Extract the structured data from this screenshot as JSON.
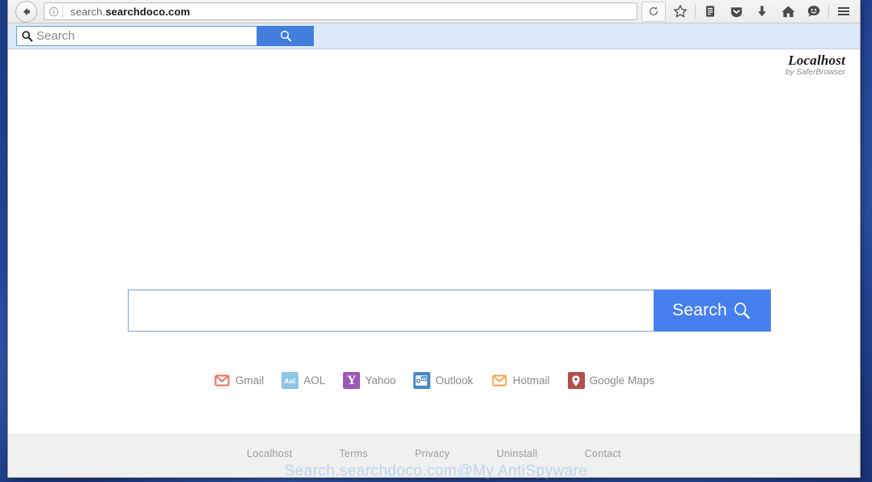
{
  "browser": {
    "back_icon": "back-arrow-icon",
    "identity_icon": "info-circle-icon",
    "url_prefix": "search.",
    "url_domain": "searchdoco.com",
    "url_full": "search.searchdoco.com",
    "reload_icon": "reload-icon",
    "toolbar_icons": [
      {
        "name": "bookmark-star-icon",
        "title": "Bookmark this page"
      },
      {
        "name": "reader-list-icon",
        "title": "Show your library"
      },
      {
        "name": "pocket-shield-icon",
        "title": "Save to Pocket"
      },
      {
        "name": "download-arrow-icon",
        "title": "Downloads"
      },
      {
        "name": "home-icon",
        "title": "Home"
      },
      {
        "name": "feedback-smiley-icon",
        "title": "Feedback"
      },
      {
        "name": "hamburger-menu-icon",
        "title": "Open menu"
      }
    ],
    "search_toolbar": {
      "placeholder": "Search",
      "magnifier_icon": "search-icon",
      "go_icon": "search-icon",
      "accent_color": "#417ede",
      "band_color": "#dde9f8"
    }
  },
  "page": {
    "brand": {
      "name": "Localhost",
      "subtitle": "by SaferBrowser"
    },
    "search": {
      "value": "",
      "placeholder": "",
      "button_label": "Search",
      "button_icon": "search-icon",
      "button_color": "#4680ef",
      "border_color": "#7aa7dd"
    },
    "quicklinks": [
      {
        "label": "Gmail",
        "icon": "gmail-envelope-icon",
        "icon_class": "gmail",
        "color": "#e8756b"
      },
      {
        "label": "AOL",
        "icon": "aol-badge-icon",
        "icon_class": "aol",
        "color": "#8fc4e8",
        "text": "Aol."
      },
      {
        "label": "Yahoo",
        "icon": "yahoo-y-icon",
        "icon_class": "yahoo",
        "color": "#9b59b6",
        "text": "Y"
      },
      {
        "label": "Outlook",
        "icon": "outlook-envelope-icon",
        "icon_class": "outlook",
        "color": "#4a89c4"
      },
      {
        "label": "Hotmail",
        "icon": "hotmail-envelope-icon",
        "icon_class": "hotmail",
        "color": "#f0ab5c"
      },
      {
        "label": "Google Maps",
        "icon": "map-pin-icon",
        "icon_class": "maps",
        "color": "#b1504f"
      }
    ],
    "footer_links": [
      {
        "label": "Localhost"
      },
      {
        "label": "Terms"
      },
      {
        "label": "Privacy"
      },
      {
        "label": "Uninstall"
      },
      {
        "label": "Contact"
      }
    ]
  },
  "watermark": {
    "text": "Search.searchdoco.com@My AntiSpyware"
  }
}
